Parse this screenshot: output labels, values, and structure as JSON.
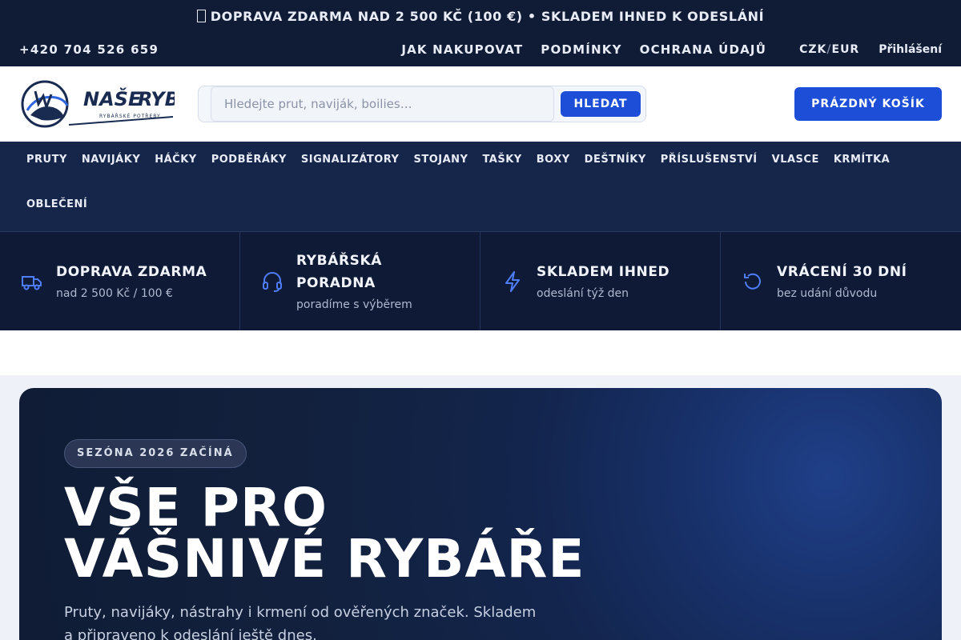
{
  "promo": {
    "text": "DOPRAVA ZDARMA NAD 2 500 KČ (100 €) • SKLADEM IHNED K ODESLÁNÍ"
  },
  "utility": {
    "phone": "+420 704 526 659",
    "links": [
      "JAK NAKUPOVAT",
      "PODMÍNKY",
      "OCHRANA ÚDAJŮ"
    ],
    "currency_czk": "CZK",
    "currency_sep": "/",
    "currency_eur": "EUR",
    "login": "Přihlášení"
  },
  "header": {
    "logo_text_1": "NAŠE",
    "logo_text_2": "RYBY",
    "logo_tagline": "RYBÁŘSKÉ POTŘEBY",
    "search_placeholder": "Hledejte prut, naviják, boilies…",
    "search_button": "HLEDAT",
    "cart": "PRÁZDNÝ KOŠÍK"
  },
  "categories": [
    "PRUTY",
    "NAVIJÁKY",
    "HÁČKY",
    "PODBĚRÁKY",
    "SIGNALIZÁTORY",
    "STOJANY",
    "TAŠKY",
    "BOXY",
    "DEŠTNÍKY",
    "PŘÍSLUŠENSTVÍ",
    "VLASCE",
    "KRMÍTKA",
    "OBLEČENÍ"
  ],
  "features": [
    {
      "title": "DOPRAVA ZDARMA",
      "subtitle": "nad 2 500 Kč / 100 €",
      "icon": "truck-icon"
    },
    {
      "title": "RYBÁŘSKÁ PORADNA",
      "subtitle": "poradíme s výběrem",
      "icon": "headset-icon"
    },
    {
      "title": "SKLADEM IHNED",
      "subtitle": "odeslání týž den",
      "icon": "lightning-icon"
    },
    {
      "title": "VRÁCENÍ 30 DNÍ",
      "subtitle": "bez udání důvodu",
      "icon": "return-icon"
    }
  ],
  "hero": {
    "badge": "SEZÓNA 2026 ZAČÍNÁ",
    "title_line1": "VŠE PRO",
    "title_line2": "VÁŠNIVÉ RYBÁŘE",
    "text": "Pruty, navijáky, nástrahy i krmení od ověřených značek. Skladem a připraveno k odeslání ještě dnes."
  },
  "colors": {
    "dark": "#101c36",
    "nav": "#16264a",
    "accent": "#1d4ed8",
    "icon": "#4f7dff"
  }
}
